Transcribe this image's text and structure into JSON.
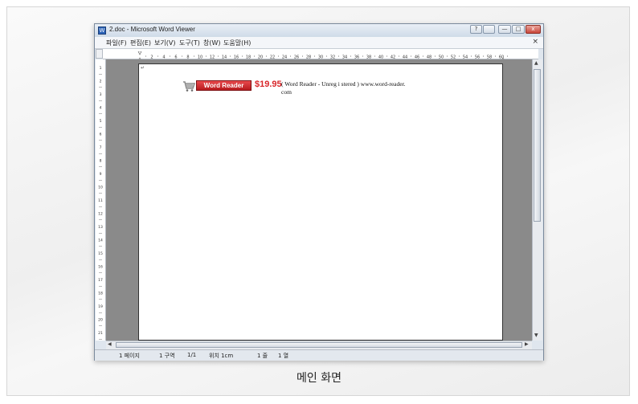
{
  "window": {
    "title": "2.doc - Microsoft Word Viewer",
    "buttons": {
      "help": "?",
      "minimize": "—",
      "maximize": "□",
      "close": "x"
    }
  },
  "menu": [
    "파일(F)",
    "편집(E)",
    "보기(V)",
    "도구(T)",
    "창(W)",
    "도움말(H)"
  ],
  "menu_close": "×",
  "ruler": {
    "marks": [
      "2",
      "4",
      "6",
      "8",
      "10",
      "12",
      "14",
      "16",
      "18",
      "20",
      "22",
      "24",
      "26",
      "28",
      "30",
      "32",
      "34",
      "36",
      "38",
      "40",
      "42",
      "44",
      "46",
      "48",
      "50",
      "52",
      "54",
      "56",
      "58",
      "60"
    ],
    "vertical_marks": [
      "1",
      "2",
      "3",
      "4",
      "5",
      "6",
      "7",
      "8",
      "9",
      "10",
      "11",
      "12",
      "13",
      "14",
      "15",
      "16",
      "17",
      "18",
      "19",
      "20",
      "21"
    ]
  },
  "document": {
    "paragraph_mark": "↵",
    "ad_brand": "Word Reader",
    "ad_price": "$19.95",
    "ad_text_line1": "( Word Reader - Unreg i stered ) www.word-reader.",
    "ad_text_line2": "com"
  },
  "status": {
    "page": "1 페이지",
    "section": "1 구역",
    "pages": "1/1",
    "position": "위치 1cm",
    "line": "1 줄",
    "column": "1 열"
  },
  "caption": "메인 화면",
  "colors": {
    "ad_red": "#d8262a",
    "doc_bg": "#8a8a8a",
    "accent": "#2b63b8"
  }
}
